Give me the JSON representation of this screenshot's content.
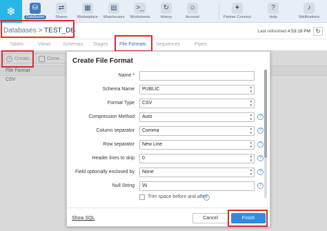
{
  "nav": {
    "items": [
      {
        "label": "Databases",
        "icon": "database-icon",
        "glyph": "⛁",
        "active": true
      },
      {
        "label": "Shares",
        "icon": "share-icon",
        "glyph": "⇄"
      },
      {
        "label": "Marketplace",
        "icon": "marketplace-icon",
        "glyph": "▦"
      },
      {
        "label": "Warehouses",
        "icon": "warehouse-icon",
        "glyph": "▤"
      },
      {
        "label": "Worksheets",
        "icon": "terminal-icon",
        "glyph": ">_"
      },
      {
        "label": "History",
        "icon": "history-icon",
        "glyph": "↻"
      },
      {
        "label": "Account",
        "icon": "account-icon",
        "glyph": "☺"
      }
    ],
    "right": [
      {
        "label": "Partner Connect",
        "icon": "partner-connect-icon",
        "glyph": "✦"
      },
      {
        "label": "Help",
        "icon": "help-icon",
        "glyph": "?"
      },
      {
        "label": "Notifications",
        "icon": "bell-icon",
        "glyph": "♪"
      }
    ]
  },
  "breadcrumb": {
    "parent": "Databases",
    "separator": ">",
    "current": "TEST_DB"
  },
  "refresh": {
    "label": "Last refreshed",
    "time": "4:53:19 PM"
  },
  "tabs": [
    {
      "label": "Tables"
    },
    {
      "label": "Views"
    },
    {
      "label": "Schemas"
    },
    {
      "label": "Stages"
    },
    {
      "label": "File Formats",
      "active": true
    },
    {
      "label": "Sequences"
    },
    {
      "label": "Pipes"
    }
  ],
  "toolbar": {
    "create_label": "Create...",
    "clone_label": "Clone..."
  },
  "list": {
    "header": "File Format",
    "rows": [
      "CSV"
    ]
  },
  "dialog": {
    "title": "Create File Format",
    "fields": {
      "name": {
        "label": "Name *",
        "value": ""
      },
      "schema": {
        "label": "Schema Name",
        "value": "PUBLIC"
      },
      "format_type": {
        "label": "Format Type",
        "value": "CSV"
      },
      "compression": {
        "label": "Compression Method",
        "value": "Auto"
      },
      "column_sep": {
        "label": "Column separator",
        "value": "Comma"
      },
      "row_sep": {
        "label": "Row separator",
        "value": "New Line"
      },
      "header_lines": {
        "label": "Header lines to skip",
        "value": "0"
      },
      "enclosed_by": {
        "label": "Field optionally enclosed by",
        "value": "None"
      },
      "null_string": {
        "label": "Null String",
        "value": "\\N"
      }
    },
    "trim_label": "Trim space before and after",
    "show_sql": "Show SQL",
    "cancel_label": "Cancel",
    "finish_label": "Finish"
  },
  "colors": {
    "accent": "#2f8ae0",
    "highlight": "#d62b2b",
    "brand": "#29b5e8"
  }
}
